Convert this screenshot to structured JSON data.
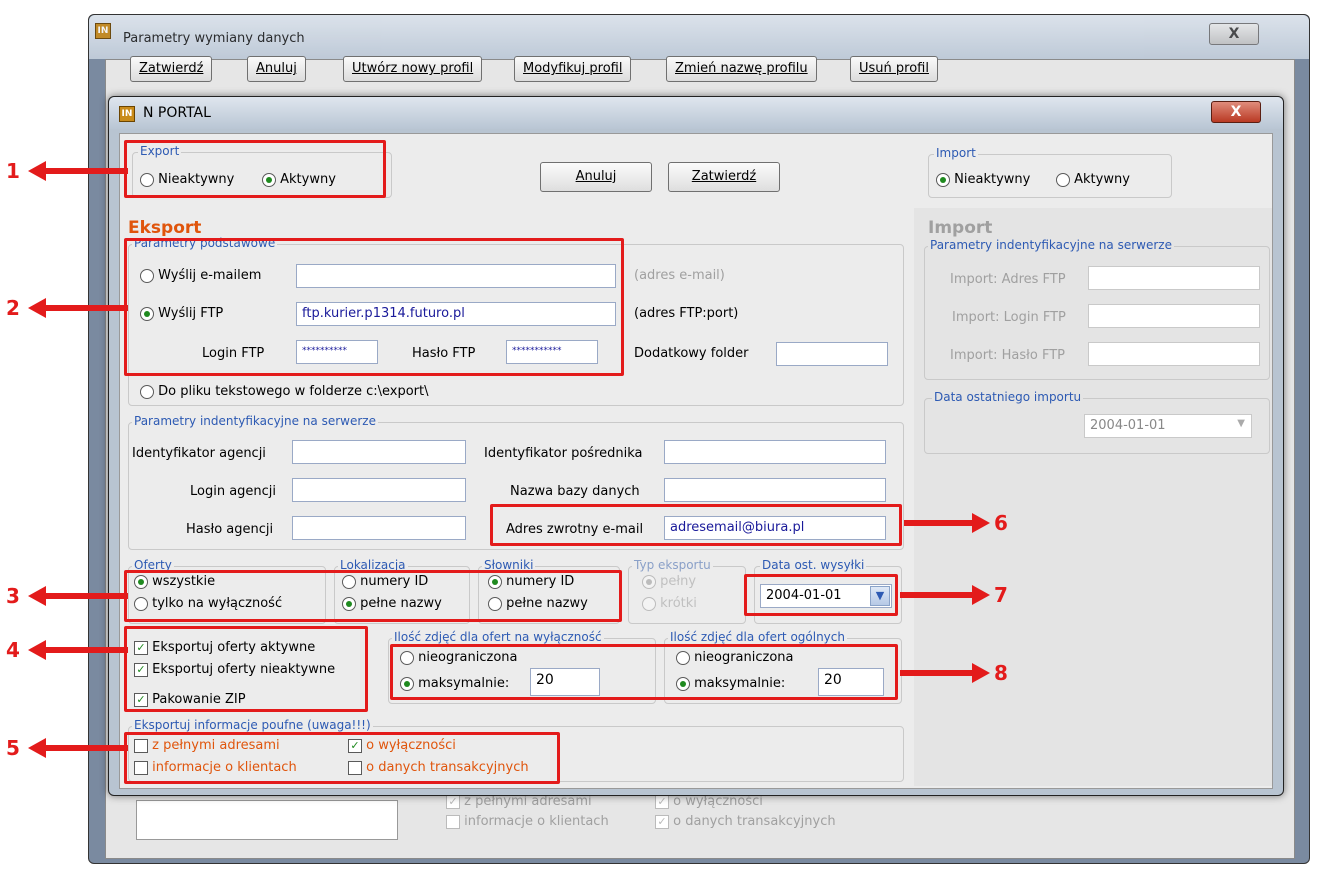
{
  "back_window": {
    "title": "Parametry wymiany danych",
    "close": "X",
    "buttons": {
      "confirm": "Zatwierdź",
      "cancel": "Anuluj",
      "new_profile": "Utwórz nowy profil",
      "modify_profile": "Modyfikuj profil",
      "rename_profile": "Zmień nazwę profilu",
      "delete_profile": "Usuń profil"
    },
    "hidden_checks": {
      "full_addresses": "z pełnymi adresami",
      "exclusivity": "o wyłączności",
      "client_info": "informacje o klientach",
      "transaction_data": "o danych transakcyjnych"
    }
  },
  "window": {
    "title": "N PORTAL",
    "close": "X",
    "icon_text": "IN"
  },
  "export_toggle": {
    "legend": "Export",
    "inactive": "Nieaktywny",
    "active": "Aktywny"
  },
  "import_toggle": {
    "legend": "Import",
    "inactive": "Nieaktywny",
    "active": "Aktywny"
  },
  "actions": {
    "cancel": "Anuluj",
    "confirm": "Zatwierdź"
  },
  "eksport": {
    "heading": "Eksport",
    "basic": {
      "legend": "Parametry podstawowe",
      "email_label": "Wyślij e-mailem",
      "email_value": "",
      "email_hint": "(adres e-mail)",
      "ftp_label": "Wyślij FTP",
      "ftp_value": "ftp.kurier.p1314.futuro.pl",
      "ftp_hint": "(adres FTP:port)",
      "login_label": "Login FTP",
      "login_value": "**********",
      "pass_label": "Hasło FTP",
      "pass_value": "***********",
      "folder_label": "Dodatkowy folder",
      "folder_value": "",
      "file_label": "Do pliku tekstowego w folderze c:\\export\\"
    },
    "server": {
      "legend": "Parametry indentyfikacyjne na serwerze",
      "agency_id": "Identyfikator agencji",
      "agency_login": "Login agencji",
      "agency_pass": "Hasło agencji",
      "broker_id": "Identyfikator pośrednika",
      "db_name": "Nazwa bazy danych",
      "return_email": "Adres zwrotny e-mail",
      "return_email_value": "adresemail@biura.pl"
    },
    "oferty": {
      "legend": "Oferty",
      "all": "wszystkie",
      "exclusive": "tylko na wyłączność"
    },
    "lokalizacja": {
      "legend": "Lokalizacja",
      "ids": "numery ID",
      "full": "pełne nazwy"
    },
    "slowniki": {
      "legend": "Słowniki",
      "ids": "numery ID",
      "full": "pełne nazwy"
    },
    "typ": {
      "legend": "Typ eksportu",
      "full": "pełny",
      "short": "krótki"
    },
    "data": {
      "legend": "Data ost. wysyłki",
      "value": "2004-01-01"
    },
    "checks": {
      "active": "Eksportuj oferty aktywne",
      "inactive": "Eksportuj oferty nieaktywne",
      "zip": "Pakowanie ZIP"
    },
    "photos_excl": {
      "legend": "Ilość zdjęć dla ofert na wyłączność",
      "unlimited": "nieograniczona",
      "max": "maksymalnie:",
      "value": "20"
    },
    "photos_gen": {
      "legend": "Ilość zdjęć dla ofert ogólnych",
      "unlimited": "nieograniczona",
      "max": "maksymalnie:",
      "value": "20"
    },
    "confidential": {
      "legend": "Eksportuj informacje poufne (uwaga!!!)",
      "full_addresses": "z pełnymi adresami",
      "exclusivity": "o wyłączności",
      "client_info": "informacje o klientach",
      "transaction_data": "o danych transakcyjnych"
    }
  },
  "import": {
    "heading": "Import",
    "server": {
      "legend": "Parametry indentyfikacyjne na serwerze",
      "ftp": "Import: Adres FTP",
      "login": "Import: Login FTP",
      "pass": "Import: Hasło FTP"
    },
    "last": {
      "legend": "Data ostatniego importu",
      "value": "2004-01-01"
    }
  },
  "annotations": [
    "1",
    "2",
    "3",
    "4",
    "5",
    "6",
    "7",
    "8"
  ],
  "colors": {
    "annotation": "#e31b1b",
    "heading": "#e0550c",
    "legend": "#2d5ab3",
    "radio_on": "#1f8a1f"
  },
  "icons": [
    "app-icon",
    "close-icon",
    "radio",
    "checkbox",
    "chevron-down-icon",
    "arrow-icon"
  ]
}
